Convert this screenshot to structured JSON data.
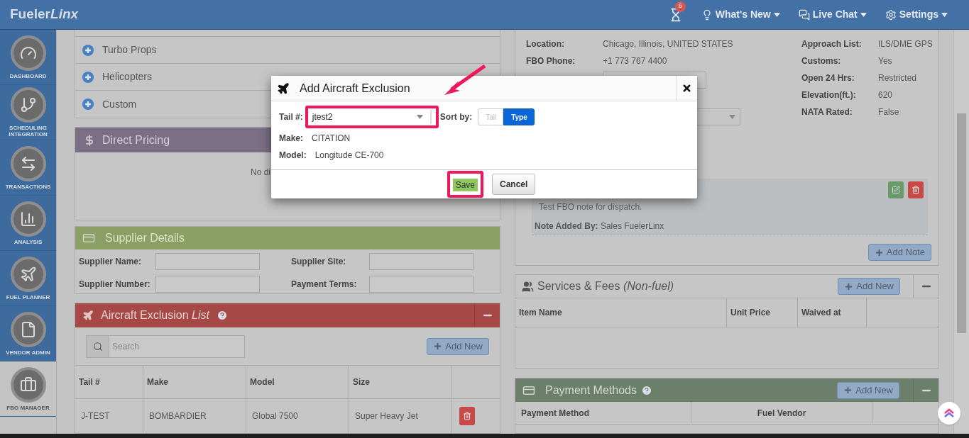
{
  "header": {
    "logo": {
      "first": "Fueler",
      "second": "Linx"
    },
    "notifications": {
      "count": "6"
    },
    "menus": [
      {
        "kind": "bulb",
        "label": "What's New"
      },
      {
        "kind": "chat",
        "label": "Live Chat"
      },
      {
        "kind": "gear",
        "label": "Settings"
      }
    ]
  },
  "sidebar": {
    "items": [
      {
        "kind": "gauge",
        "label": "DASHBOARD",
        "selected": false
      },
      {
        "kind": "branch",
        "label": "SCHEDULING INTEGRATION",
        "selected": false
      },
      {
        "kind": "arrows",
        "label": "TRANSACTIONS",
        "selected": false
      },
      {
        "kind": "chart",
        "label": "ANALYSIS",
        "selected": false
      },
      {
        "kind": "plane",
        "label": "FUEL PLANNER",
        "selected": false
      },
      {
        "kind": "file",
        "label": "VENDOR ADMIN",
        "selected": false
      },
      {
        "kind": "briefcase",
        "label": "FBO MANAGER",
        "selected": true
      }
    ]
  },
  "fleet_panel": {
    "items": [
      "Turbo Props",
      "Helicopters",
      "Custom"
    ]
  },
  "direct_pricing": {
    "title": "Direct Pricing",
    "message": "No di"
  },
  "supplier_details": {
    "title": "Supplier Details",
    "fields": [
      "Supplier Name:",
      "Supplier Site:",
      "Supplier Number:",
      "Payment Terms:"
    ]
  },
  "aircraft_exclusion": {
    "title": "Aircraft Exclusion *List*",
    "search_placeholder": "Search",
    "add_button": "Add New",
    "columns": [
      "Tail #",
      "Make",
      "Model",
      "Size"
    ],
    "rows": [
      {
        "tail": "J-TEST",
        "make": "BOMBARDIER",
        "model": "Global 7500",
        "size": "Super Heavy Jet"
      }
    ]
  },
  "fbo_info": {
    "left": [
      {
        "label": "Location:",
        "value": "Chicago, Illinois, UNITED STATES"
      },
      {
        "label": "FBO Phone:",
        "value": "+1 773 767 4400"
      }
    ],
    "right": [
      {
        "label": "Approach List:",
        "value": "ILS/DME GPS"
      },
      {
        "label": "Customs:",
        "value": "Yes"
      },
      {
        "label": "Open 24 Hrs:",
        "value": "Restricted"
      },
      {
        "label": "Elevation(ft.):",
        "value": "620"
      },
      {
        "label": "NATA Rated:",
        "value": "False"
      }
    ],
    "note": {
      "text": "Test FBO note for dispatch.",
      "added_by": "**Note Added By:** Sales FuelerLinx"
    },
    "add_note": "Add Note"
  },
  "services": {
    "title": "Services & Fees *(Non-fuel)*",
    "add_button": "Add New",
    "columns": [
      "Item Name",
      "Unit Price",
      "Waived at"
    ]
  },
  "payment_methods": {
    "title": "Payment Methods",
    "add_button": "Add New",
    "columns": [
      "Payment Method",
      "Fuel Vendor"
    ]
  },
  "modal": {
    "title": "Add Aircraft Exclusion",
    "tail_label": "Tail #:",
    "tail_value": "jtest2",
    "sort_label": "Sort by:",
    "sort_options": [
      {
        "label": "Tail",
        "selected": false
      },
      {
        "label": "Type",
        "selected": true
      }
    ],
    "make_label": "Make:",
    "make_value": "CITATION",
    "model_label": "Model:",
    "model_value": "Longitude CE-700",
    "save": "Save",
    "cancel": "Cancel"
  }
}
